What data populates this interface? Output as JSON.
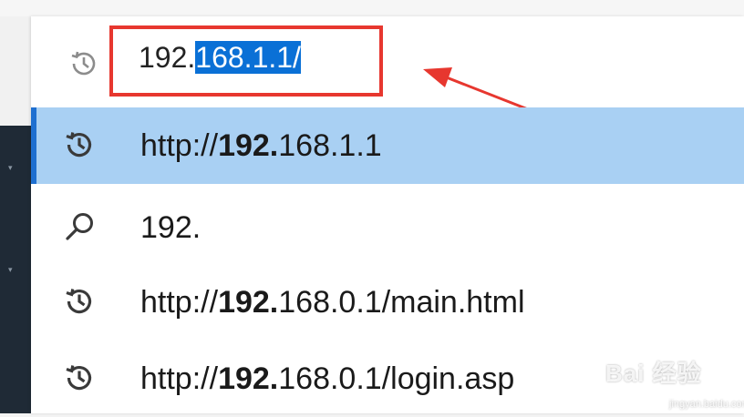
{
  "address_bar": {
    "value_prefix": "192.",
    "value_selected": "168.1.1/",
    "icon": "history-icon"
  },
  "suggestions": [
    {
      "icon": "history-icon",
      "prefix": "http://",
      "bold": "192.",
      "rest": "168.1.1",
      "selected": true
    },
    {
      "icon": "search-icon",
      "prefix": "",
      "bold": "",
      "rest": "192.",
      "selected": false
    },
    {
      "icon": "history-icon",
      "prefix": "http://",
      "bold": "192.",
      "rest": "168.0.1/main.html",
      "selected": false
    },
    {
      "icon": "history-icon",
      "prefix": "http://",
      "bold": "192.",
      "rest": "168.0.1/login.asp",
      "selected": false
    }
  ],
  "watermark": {
    "logo_text": "Bai 经验",
    "url_text": "jingyan.baidu.com"
  },
  "colors": {
    "selection": "#0a70d6",
    "selected_row": "#a9d0f3",
    "annotation_red": "#e7372f"
  }
}
